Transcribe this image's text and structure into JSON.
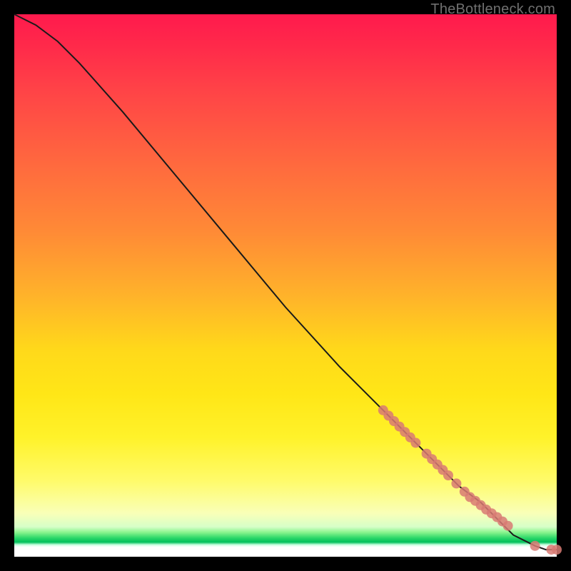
{
  "watermark": "TheBottleneck.com",
  "colors": {
    "page_bg": "#000000",
    "curve": "#1a1a1a",
    "points": "#d87a73"
  },
  "chart_data": {
    "type": "line",
    "title": "",
    "xlabel": "",
    "ylabel": "",
    "xlim": [
      0,
      100
    ],
    "ylim": [
      0,
      100
    ],
    "grid": false,
    "series": [
      {
        "name": "trend",
        "kind": "line",
        "x": [
          0,
          4,
          8,
          12,
          20,
          30,
          40,
          50,
          60,
          68,
          74,
          78,
          82,
          86,
          88,
          90,
          92,
          94,
          96,
          98,
          100
        ],
        "y": [
          100,
          98,
          95,
          91,
          82,
          70,
          58,
          46,
          35,
          27,
          21,
          17,
          13,
          10,
          8,
          6,
          4,
          3,
          2,
          1.3,
          1.3
        ]
      },
      {
        "name": "points",
        "kind": "scatter",
        "x": [
          68,
          69,
          70,
          71,
          72,
          73,
          74,
          76,
          77,
          78,
          79,
          80,
          81.5,
          83,
          84,
          85,
          86,
          87,
          88,
          89,
          90,
          91,
          96,
          99,
          100
        ],
        "y": [
          27,
          26,
          25,
          24,
          23,
          22,
          21,
          19,
          18,
          17,
          16,
          15,
          13.5,
          12,
          11,
          10.3,
          9.5,
          8.7,
          8,
          7.3,
          6.5,
          5.7,
          2,
          1.3,
          1.3
        ]
      }
    ]
  }
}
